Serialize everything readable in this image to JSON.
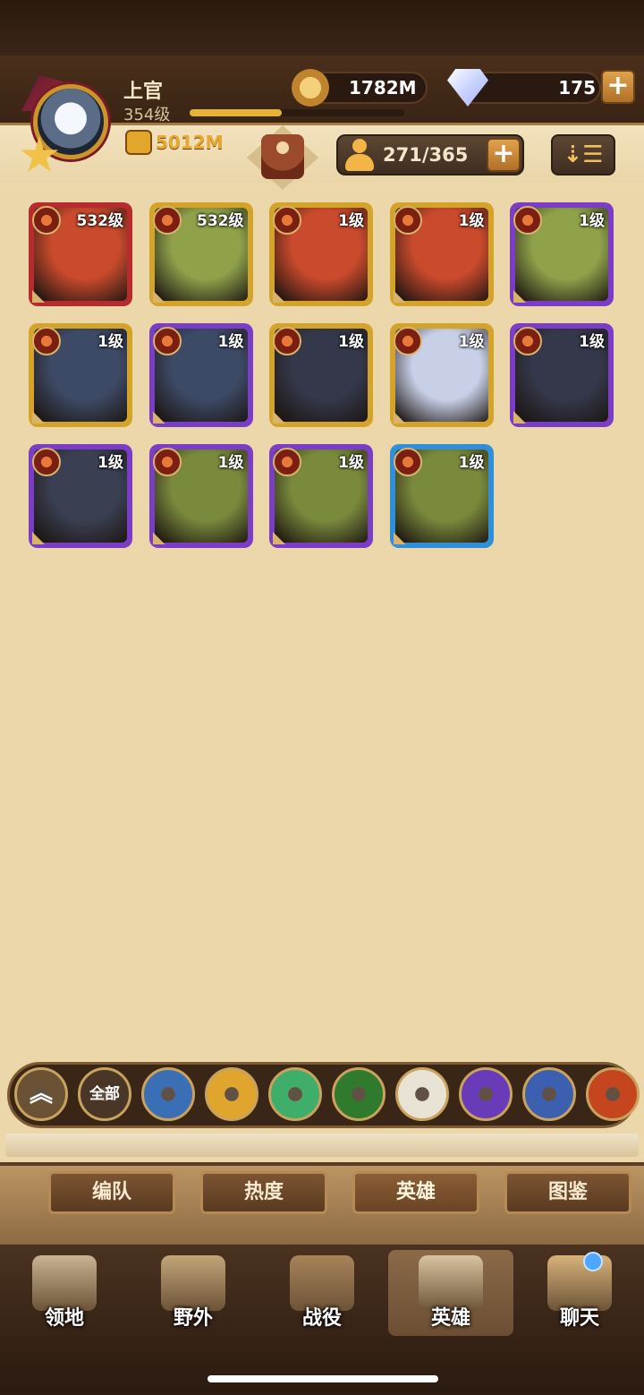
{
  "player": {
    "name": "上官",
    "level": "354级",
    "xp_progress": 0.43,
    "power": "5012M"
  },
  "resources": {
    "coins": "1782M",
    "gems": "175",
    "roster": "271/365"
  },
  "heroes": [
    {
      "level": "532级",
      "frame": "#b52b2e",
      "portrait": "#c94a2c"
    },
    {
      "level": "532级",
      "frame": "#d4a32a",
      "portrait": "#8fa24a"
    },
    {
      "level": "1级",
      "frame": "#d4a32a",
      "portrait": "#c94a2c"
    },
    {
      "level": "1级",
      "frame": "#d4a32a",
      "portrait": "#c94a2c"
    },
    {
      "level": "1级",
      "frame": "#7b3cc6",
      "portrait": "#8fa24a"
    },
    {
      "level": "1级",
      "frame": "#d4a32a",
      "portrait": "#3d4a66"
    },
    {
      "level": "1级",
      "frame": "#7b3cc6",
      "portrait": "#3d4a66"
    },
    {
      "level": "1级",
      "frame": "#d4a32a",
      "portrait": "#34384a"
    },
    {
      "level": "1级",
      "frame": "#d4a32a",
      "portrait": "#c8d0e8"
    },
    {
      "level": "1级",
      "frame": "#7b3cc6",
      "portrait": "#34384a"
    },
    {
      "level": "1级",
      "frame": "#7b3cc6",
      "portrait": "#3a3f52"
    },
    {
      "level": "1级",
      "frame": "#7b3cc6",
      "portrait": "#7a8a3c"
    },
    {
      "level": "1级",
      "frame": "#7b3cc6",
      "portrait": "#7a8a3c"
    },
    {
      "level": "1级",
      "frame": "#2f8fd8",
      "portrait": "#7a8a3c"
    }
  ],
  "faction_filter": {
    "all_label": "全部",
    "items": [
      {
        "name": "rank-up-icon",
        "color": "#6b5234"
      },
      {
        "name": "all-filter",
        "color": "#4a3626"
      },
      {
        "name": "lightbearer-icon",
        "color": "#3b6fb5"
      },
      {
        "name": "mauler-icon",
        "color": "#e0a52c"
      },
      {
        "name": "wilder-icon",
        "color": "#3fae6a"
      },
      {
        "name": "graveborn-icon",
        "color": "#2f7a2c"
      },
      {
        "name": "celestial-icon",
        "color": "#e9e3d6"
      },
      {
        "name": "hypogean-icon",
        "color": "#6a3bb8"
      },
      {
        "name": "dimensional-icon",
        "color": "#3d5fb0"
      },
      {
        "name": "faction-red-icon",
        "color": "#c5461e"
      }
    ]
  },
  "sub_tabs": [
    "编队",
    "热度",
    "英雄",
    "图鉴"
  ],
  "nav": [
    {
      "label": "领地",
      "color": "#c9b393"
    },
    {
      "label": "野外",
      "color": "#c2a678"
    },
    {
      "label": "战役",
      "color": "#a8835a"
    },
    {
      "label": "英雄",
      "color": "#d8c3a0"
    },
    {
      "label": "聊天",
      "color": "#d7b27a"
    }
  ]
}
